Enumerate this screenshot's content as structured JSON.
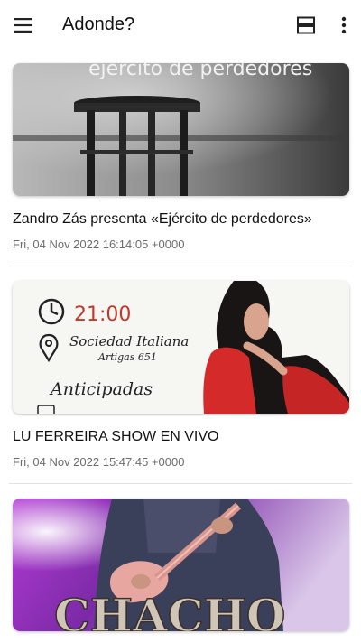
{
  "app": {
    "title": "Adonde?",
    "menu_icon": "hamburger-menu-icon",
    "view_icon": "view-agenda-icon",
    "more_icon": "more-vert-icon"
  },
  "feed": {
    "items": [
      {
        "headline": "Zandro Zás presenta «Ejército de perdedores»",
        "date": "Fri, 04 Nov 2022 16:14:05 +0000",
        "image_text": "ejército de perdedores"
      },
      {
        "headline": "LU FERREIRA SHOW EN VIVO",
        "date": "Fri, 04 Nov 2022 15:47:45 +0000",
        "image_text": {
          "time": "21:00",
          "venue": "Sociedad Italiana",
          "address": "Artigas 651",
          "tickets": "Anticipadas"
        }
      },
      {
        "image_text": "CHACHO"
      }
    ]
  }
}
